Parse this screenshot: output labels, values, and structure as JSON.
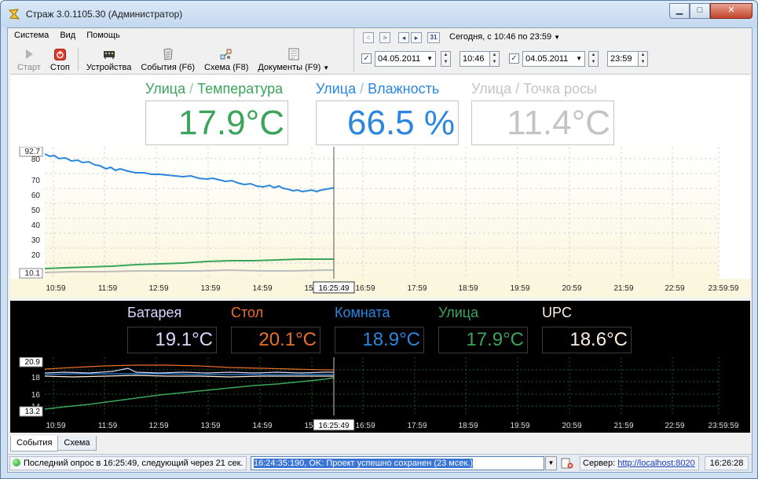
{
  "window": {
    "title": "Страж 3.0.1105.30 (Администратор)",
    "controls": {
      "minimize": "▁",
      "maximize": "□",
      "close": "✕"
    }
  },
  "menu": [
    "Система",
    "Вид",
    "Помощь"
  ],
  "toolbar": {
    "start": {
      "label": "Старт",
      "icon": "play-icon"
    },
    "stop": {
      "label": "Стоп",
      "icon": "stop-icon"
    },
    "devices": {
      "label": "Устройства",
      "icon": "devices-icon"
    },
    "events": {
      "label": "События (F6)",
      "icon": "events-icon"
    },
    "scheme": {
      "label": "Схема (F8)",
      "icon": "scheme-icon"
    },
    "documents": {
      "label": "Документы (F9)",
      "icon": "documents-icon"
    }
  },
  "range": {
    "label": "Сегодня, с 10:46 по 23:59",
    "calendar_day": "31",
    "from_date": "04.05.2011",
    "from_time": "10:46",
    "to_date": "04.05.2011",
    "to_time": "23:59"
  },
  "upper": {
    "tiles": [
      {
        "location": "Улица",
        "sep": " / ",
        "metric": "Температура",
        "value": "17.9°C",
        "color": "#3aa55a"
      },
      {
        "location": "Улица",
        "sep": " / ",
        "metric": "Влажность",
        "value": "66.5 %",
        "color": "#2a86de"
      },
      {
        "location": "Улица",
        "sep": " / ",
        "metric": "Точка росы",
        "value": "11.4°C",
        "color": "#c4c4c4"
      }
    ],
    "y_max_label": "92.7",
    "y_min_label": "10.1",
    "y_ticks": [
      "80",
      "70",
      "60",
      "50",
      "40",
      "30",
      "20"
    ],
    "x_ticks": [
      "10:59",
      "11:59",
      "12:59",
      "13:59",
      "14:59",
      "15:59",
      "16:59",
      "17:59",
      "18:59",
      "19:59",
      "20:59",
      "21:59",
      "22:59",
      "23:59:59"
    ],
    "cursor_time": "16:25:49"
  },
  "lower": {
    "tiles": [
      {
        "name": "Батарея",
        "value": "19.1°C",
        "color": "#d8d8ff"
      },
      {
        "name": "Стол",
        "value": "20.1°C",
        "color": "#e8702a"
      },
      {
        "name": "Комната",
        "value": "18.9°C",
        "color": "#2a86de"
      },
      {
        "name": "Улица",
        "value": "17.9°C",
        "color": "#3aa55a"
      },
      {
        "name": "UPC",
        "value": "18.6°C",
        "color": "#ffeedd"
      }
    ],
    "y_max_label": "20.9",
    "y_min_label": "13.2",
    "y_ticks": [
      "18",
      "16",
      "14"
    ],
    "x_ticks": [
      "10:59",
      "11:59",
      "12:59",
      "13:59",
      "14:59",
      "15:59",
      "16:59",
      "17:59",
      "18:59",
      "19:59",
      "20:59",
      "21:59",
      "22:59",
      "23:59:59"
    ],
    "cursor_time": "16:25:49"
  },
  "tabs": [
    "События",
    "Схема"
  ],
  "status": {
    "poll": "Последний опрос в 16:25:49, следующий через 21 сек.",
    "log": "16:24:35:190, OK: Проект успешно сохранен (23 мсек.)",
    "server_label": "Сервер:",
    "server_url": "http://localhost:8020",
    "clock": "16:26:28"
  }
}
